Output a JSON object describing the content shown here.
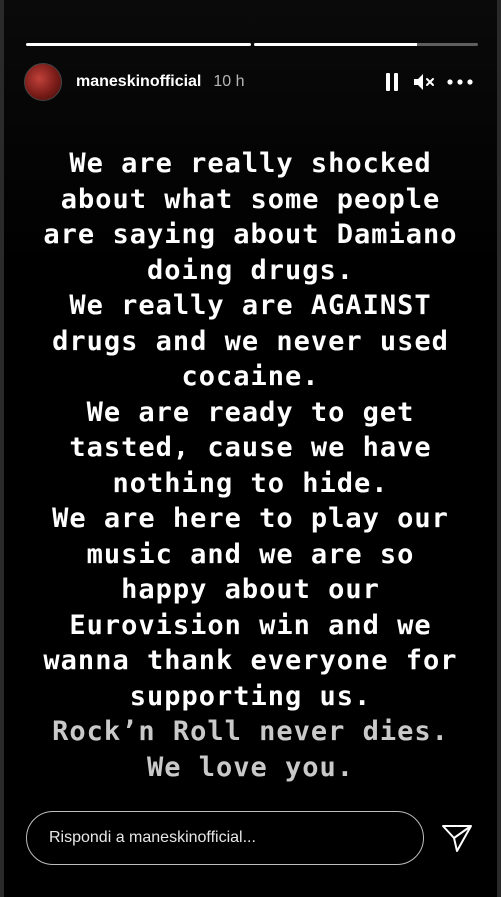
{
  "story": {
    "progress": [
      1.0,
      0.73
    ],
    "username": "maneskinofficial",
    "timestamp": "10 h",
    "lines": [
      "We are really shocked",
      "about what some people",
      "are saying about Damiano",
      "doing drugs.",
      "We really are AGAINST",
      "drugs and we never used",
      "cocaine.",
      "We are ready to get",
      "tasted, cause we have",
      "nothing to hide.",
      "We are here to play our",
      "music and we are so",
      "happy about our",
      "Eurovision win and we",
      "wanna thank everyone for",
      "supporting us.",
      "Rock’n Roll never dies.",
      "We love you."
    ]
  },
  "controls": {
    "pause_icon": "pause-icon",
    "mute_icon": "volume-muted-icon",
    "more_icon": "more-horizontal-icon"
  },
  "reply": {
    "placeholder": "Rispondi a maneskinofficial...",
    "send_icon": "send-icon"
  }
}
